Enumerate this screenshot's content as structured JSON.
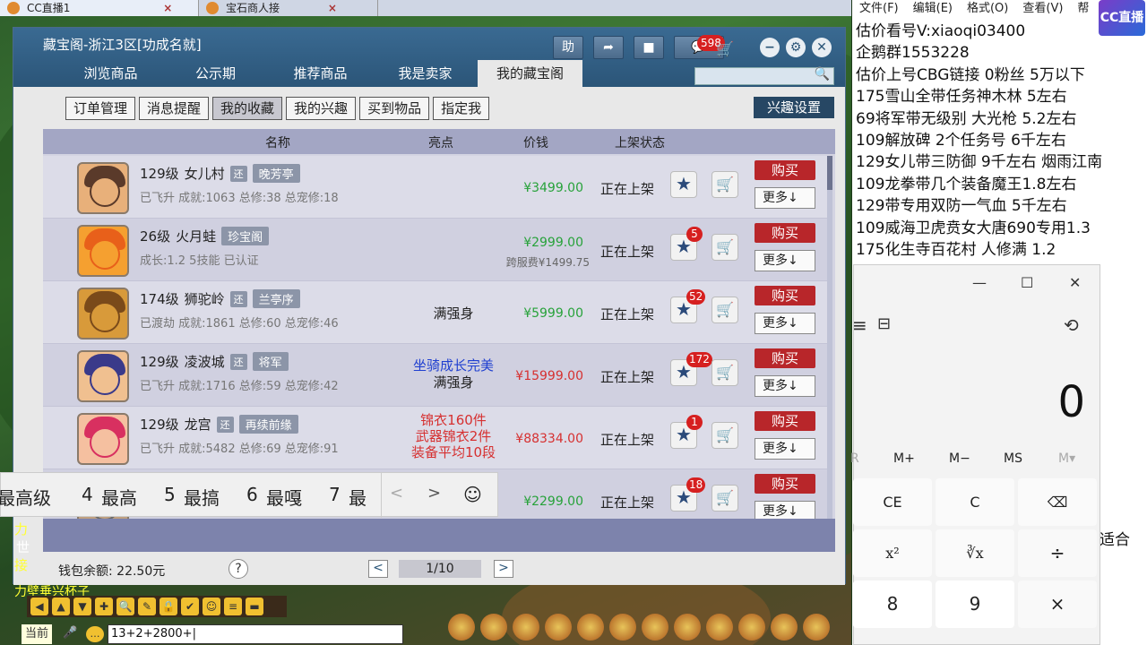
{
  "browser_tabs": [
    {
      "label": "CC直播1",
      "close": "×"
    },
    {
      "label": "宝石商人接",
      "close": "×"
    }
  ],
  "window": {
    "title": "藏宝阁-浙江3区[功成名就]",
    "help_btn": "助",
    "msg_count": "598",
    "nav_tabs": [
      "浏览商品",
      "公示期",
      "推荐商品",
      "我是卖家",
      "我的藏宝阁"
    ],
    "sub_tabs": [
      "订单管理",
      "消息提醒",
      "我的收藏",
      "我的兴趣",
      "买到物品",
      "指定我"
    ],
    "interest_settings": "兴趣设置",
    "headers": {
      "name": "名称",
      "highlight": "亮点",
      "price": "价钱",
      "status": "上架状态"
    },
    "rows": [
      {
        "level": "129级",
        "school": "女儿村",
        "tag": "还",
        "server": "晚芳亭",
        "stats": "已飞升 成就:1063 总修:38 总宠修:18",
        "highlight": "",
        "price": "¥3499.00",
        "price_color": "#27a23a",
        "sub_price": "",
        "status": "正在上架",
        "fav": "",
        "buy": "购买",
        "more": "更多↓",
        "avatar": [
          "#5a3a2a",
          "#e8b07a"
        ]
      },
      {
        "level": "26级",
        "school": "火月蛙",
        "tag": "",
        "server": "珍宝阁",
        "stats": "成长:1.2 5技能 已认证",
        "highlight": "",
        "price": "¥2999.00",
        "price_color": "#27a23a",
        "sub_price": "跨服费¥1499.75",
        "status": "正在上架",
        "fav": "5",
        "buy": "购买",
        "more": "更多↓",
        "avatar": [
          "#e8601a",
          "#f5a030"
        ]
      },
      {
        "level": "174级",
        "school": "狮驼岭",
        "tag": "还",
        "server": "兰亭序",
        "stats": "已渡劫 成就:1861 总修:60 总宠修:46",
        "highlight": "满强身",
        "price": "¥5999.00",
        "price_color": "#27a23a",
        "sub_price": "",
        "status": "正在上架",
        "fav": "52",
        "buy": "购买",
        "more": "更多↓",
        "avatar": [
          "#7a4a1a",
          "#d89a3a"
        ]
      },
      {
        "level": "129级",
        "school": "凌波城",
        "tag": "还",
        "server": "将军",
        "stats": "已飞升 成就:1716 总修:59 总宠修:42",
        "highlight": "坐骑成长完美",
        "highlight2": "满强身",
        "price": "¥15999.00",
        "price_color": "#d63030",
        "sub_price": "",
        "status": "正在上架",
        "fav": "172",
        "buy": "购买",
        "more": "更多↓",
        "avatar": [
          "#3a3a8a",
          "#f0c090"
        ]
      },
      {
        "level": "129级",
        "school": "龙宫",
        "tag": "还",
        "server": "再续前缘",
        "stats": "已飞升 成就:5482 总修:69 总宠修:91",
        "highlight": "锦衣160件",
        "highlight2": "武器锦衣2件",
        "highlight3": "装备平均10段",
        "price": "¥88334.00",
        "price_color": "#d63030",
        "sub_price": "",
        "status": "正在上架",
        "fav": "1",
        "buy": "购买",
        "more": "更多↓",
        "avatar": [
          "#d83060",
          "#f5c0a0"
        ]
      },
      {
        "level": "",
        "school": "",
        "tag": "",
        "server": "",
        "stats": "",
        "highlight": "",
        "price": "¥2299.00",
        "price_color": "#27a23a",
        "sub_price": "",
        "status": "正在上架",
        "fav": "18",
        "buy": "购买",
        "more": "更多↓",
        "avatar": [
          "#6a6a6a",
          "#c0a080"
        ]
      }
    ],
    "wallet": "钱包余额: 22.50元",
    "help": "?",
    "page": "1/10",
    "prev": "<",
    "next": ">"
  },
  "ime": {
    "c1": "最高级",
    "c4n": "4",
    "c4": "最高",
    "c5n": "5",
    "c5": "最搞",
    "c6n": "6",
    "c6": "最嘎",
    "c7n": "7",
    "c7": "最",
    "left": "<",
    "right": ">",
    "emoji": "☺"
  },
  "game": {
    "side1": "力",
    "side2": "世",
    "side3": "接",
    "chat_line": "力壁垂兴杯子",
    "chat_left": "当前",
    "chat_input": "13+2+2800+|",
    "toolbar": [
      "◀",
      "▲",
      "▼",
      "✚",
      "🔍",
      "✎",
      "🔒",
      "✔",
      "☺",
      "≡",
      "▬"
    ]
  },
  "notepad": {
    "menu": [
      "文件(F)",
      "编辑(E)",
      "格式(O)",
      "查看(V)",
      "帮"
    ],
    "logo": "CC直播",
    "lines": [
      "估价看号V:xiaoqi03400",
      "企鹅群1553228",
      "估价上号CBG链接 0粉丝 5万以下",
      "175雪山全带任务神木林 5左右",
      "69将军带无级别 大光枪 5.2左右",
      "109解放碑 2个任务号 6千左右",
      "129女儿带三防御 9千左右 烟雨江南",
      "109龙拳带几个装备魔王1.8左右",
      "129带专用双防一气血 5千左右",
      "109威海卫虎贲女大唐690专用1.3",
      "175化生寺百花村 人修满 1.2"
    ],
    "frag_right": "适合"
  },
  "calculator": {
    "min": "—",
    "max": "☐",
    "close": "✕",
    "menu_icon": "≡",
    "mode_icon": "⊟",
    "history_icon": "⟲",
    "display": "0",
    "mem": [
      "R",
      "M+",
      "M−",
      "MS",
      "M▾"
    ],
    "keys": [
      "CE",
      "C",
      "⌫",
      "x²",
      "∛x",
      "÷",
      "8",
      "9",
      "×"
    ]
  }
}
